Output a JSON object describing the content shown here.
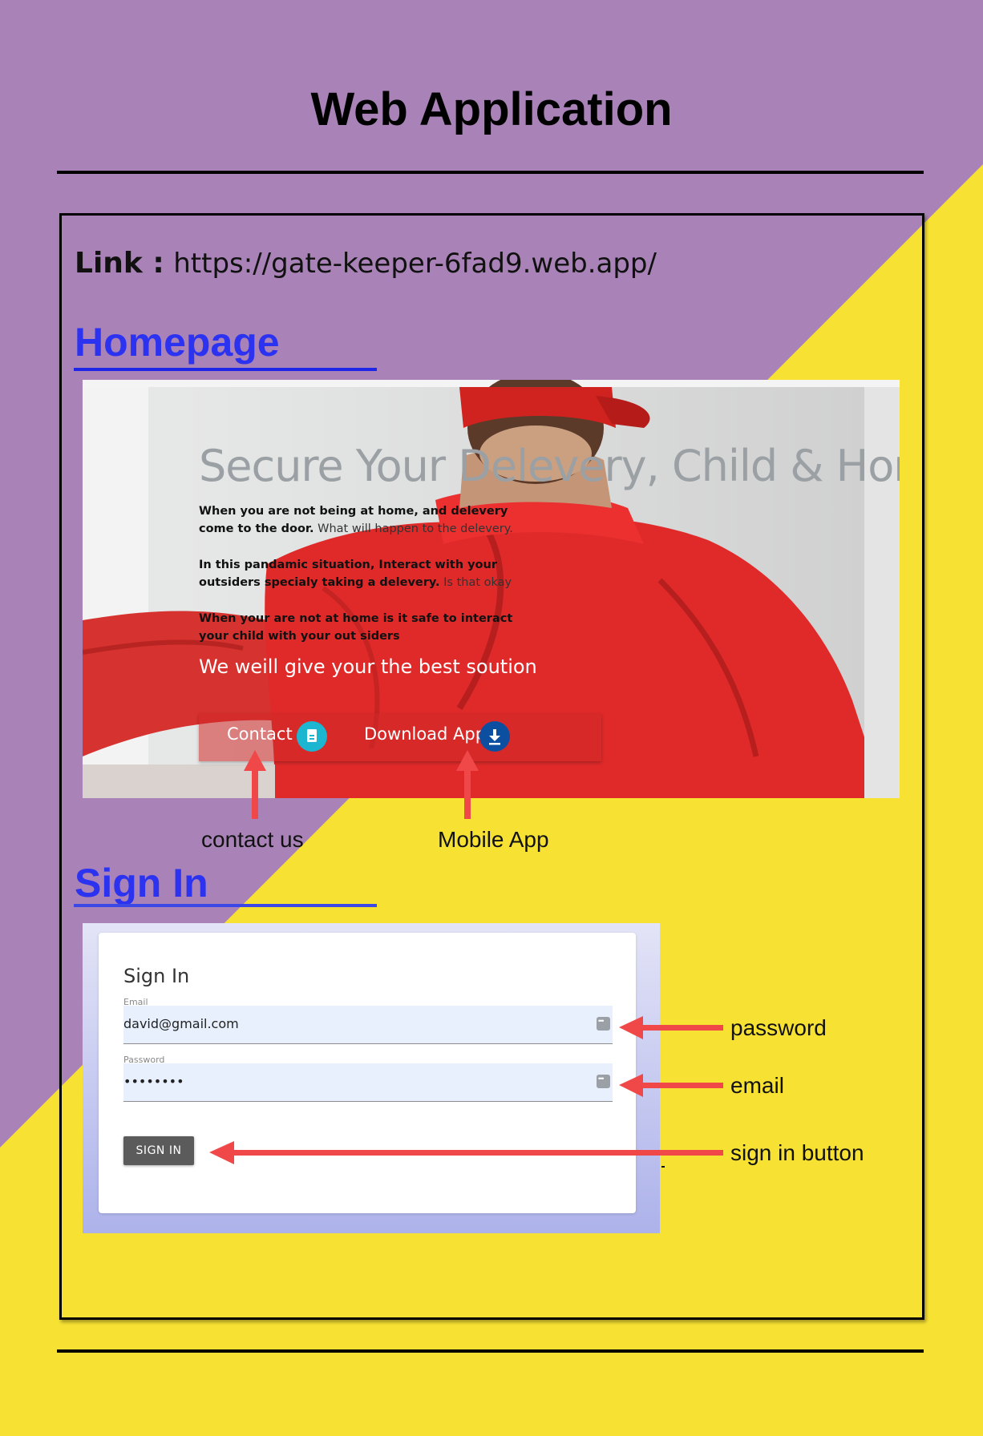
{
  "page": {
    "title": "Web Application",
    "link_label": "Link :",
    "link_url": "https://gate-keeper-6fad9.web.app/"
  },
  "sections": {
    "homepage_heading": "Homepage",
    "signin_heading": "Sign In"
  },
  "hero": {
    "title": "Secure Your Delevery, Child & Home",
    "p1_bold": "When you are not being at home, and delevery come to the door.",
    "p1_rest": " What will happen to the delevery.",
    "p2_bold": "In this pandamic situation, Interact with your outsiders specialy taking a delevery.",
    "p2_rest": " Is that okay",
    "p3_bold": "When your are not at home is it safe to interact your child with your out siders",
    "tagline": "We weill give your the best soution",
    "contact_label": "Contact",
    "download_label": "Download App",
    "contact_icon": "contact-doc-icon",
    "download_icon": "download-icon"
  },
  "annotations": {
    "contact_us": "contact us",
    "mobile_app": "Mobile App",
    "password": "password",
    "email": "email",
    "sign_in_button": "sign in button"
  },
  "signin": {
    "title": "Sign In",
    "email_label": "Email",
    "email_value": "david@gmail.com",
    "password_label": "Password",
    "password_value": "••••••••",
    "button_label": "SIGN IN"
  },
  "colors": {
    "purple": "#a983b7",
    "yellow": "#f7e234",
    "heading_blue": "#2b33f0",
    "arrow_red": "#f04848"
  }
}
